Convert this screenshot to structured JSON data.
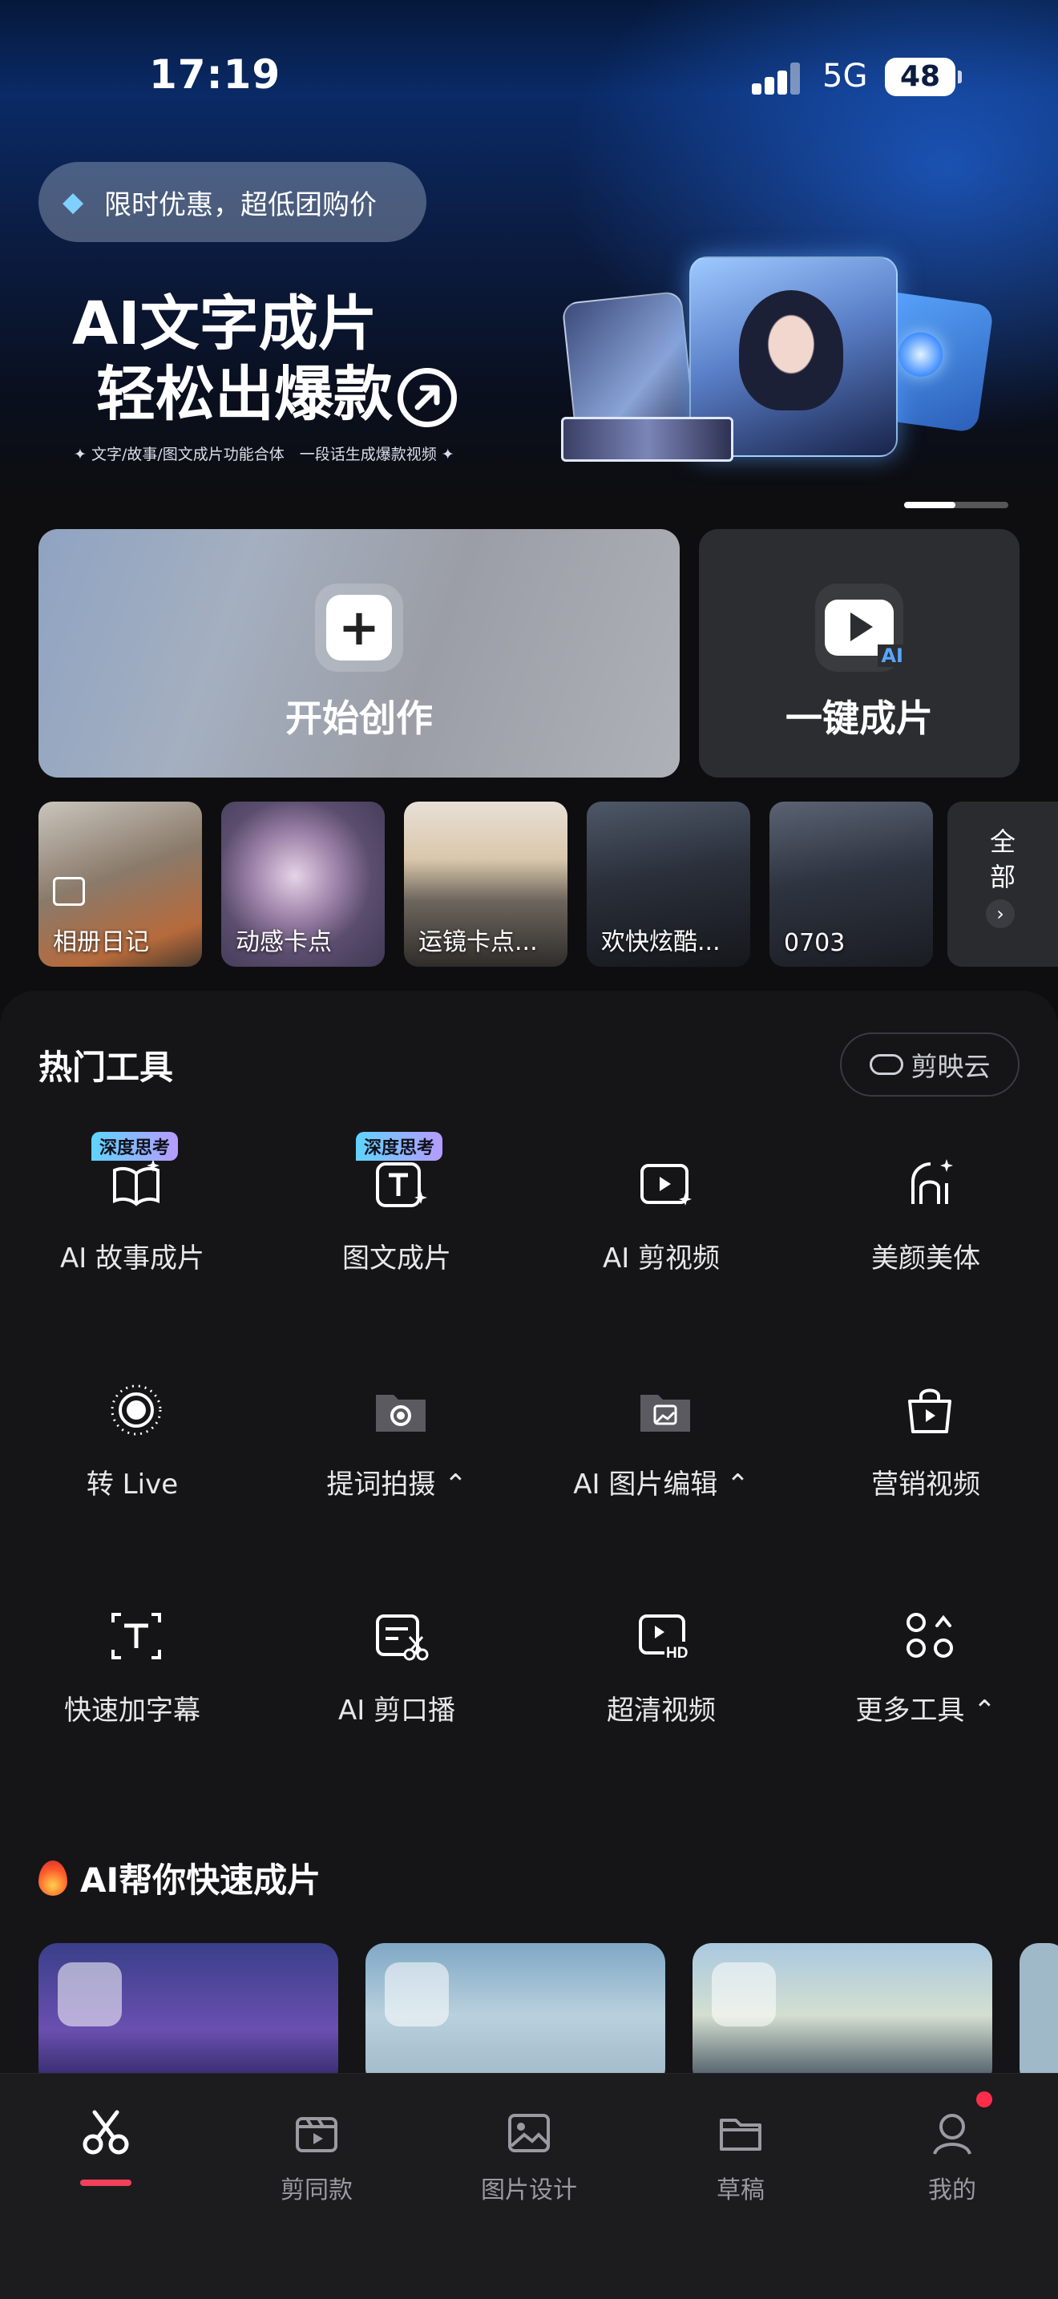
{
  "status_bar": {
    "time": "17:19",
    "network": "5G",
    "battery": "48"
  },
  "promo": {
    "label": "限时优惠，超低团购价"
  },
  "banner": {
    "title_line1": "AI文字成片",
    "title_line2": "轻松出爆款",
    "subtitle": "✦ 文字/故事/图文成片功能合体　一段话生成爆款视频 ✦"
  },
  "actions": {
    "start_create": "开始创作",
    "one_click": "一键成片",
    "one_click_badge": "AI"
  },
  "templates": [
    {
      "label": "相册日记"
    },
    {
      "label": "动感卡点"
    },
    {
      "label": "运镜卡点..."
    },
    {
      "label": "欢快炫酷..."
    },
    {
      "label": "0703"
    }
  ],
  "templates_all": {
    "label": "全部"
  },
  "hot_tools": {
    "title": "热门工具",
    "cloud_button": "剪映云",
    "items": [
      {
        "label": "AI 故事成片",
        "badge": "深度思考",
        "icon": "book-sparkle-icon"
      },
      {
        "label": "图文成片",
        "badge": "深度思考",
        "icon": "text-sparkle-icon"
      },
      {
        "label": "AI 剪视频",
        "icon": "video-sparkle-icon"
      },
      {
        "label": "美颜美体",
        "icon": "face-sparkle-icon"
      },
      {
        "label": "转 Live",
        "icon": "live-icon"
      },
      {
        "label": "提词拍摄",
        "icon": "camera-folder-icon"
      },
      {
        "label": "AI 图片编辑",
        "icon": "image-folder-icon"
      },
      {
        "label": "营销视频",
        "icon": "shopping-bag-icon"
      },
      {
        "label": "快速加字幕",
        "icon": "caption-icon"
      },
      {
        "label": "AI 剪口播",
        "icon": "text-scissors-icon"
      },
      {
        "label": "超清视频",
        "icon": "hd-video-icon"
      },
      {
        "label": "更多工具",
        "icon": "more-tools-icon"
      }
    ]
  },
  "ai_section": {
    "title": "AI帮你快速成片"
  },
  "tabbar": {
    "items": [
      {
        "label": ""
      },
      {
        "label": "剪同款"
      },
      {
        "label": "图片设计"
      },
      {
        "label": "草稿"
      },
      {
        "label": "我的"
      }
    ]
  },
  "colors": {
    "accent": "#f2405a",
    "badge_start": "#5fd3ff",
    "badge_end": "#b69bff"
  }
}
